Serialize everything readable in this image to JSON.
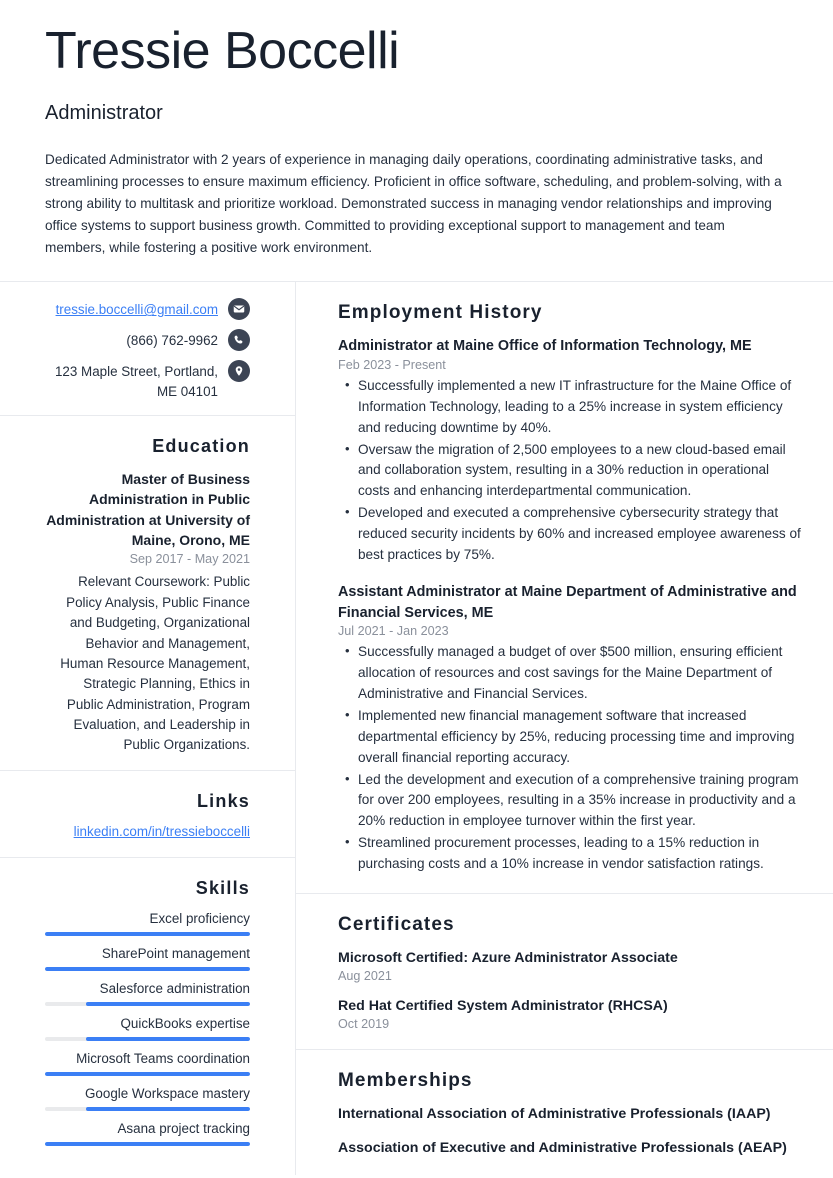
{
  "header": {
    "name": "Tressie Boccelli",
    "job_title": "Administrator",
    "summary": "Dedicated Administrator with 2 years of experience in managing daily operations, coordinating administrative tasks, and streamlining processes to ensure maximum efficiency. Proficient in office software, scheduling, and problem-solving, with a strong ability to multitask and prioritize workload. Demonstrated success in managing vendor relationships and improving office systems to support business growth. Committed to providing exceptional support to management and team members, while fostering a positive work environment."
  },
  "colors": {
    "accent": "#3b7ff5",
    "heading": "#19212e",
    "body_text": "#26303f",
    "muted": "#8a909b",
    "icon_circle": "#3c4454",
    "divider": "#e8eaee",
    "track": "#e9eaec"
  },
  "contact": {
    "email": "tressie.boccelli@gmail.com",
    "email_icon": "envelope-icon",
    "phone": "(866) 762-9962",
    "phone_icon": "phone-icon",
    "address": "123 Maple Street, Portland, ME 04101",
    "address_icon": "location-pin-icon"
  },
  "education": {
    "heading": "Education",
    "entries": [
      {
        "degree": "Master of Business Administration in Public Administration at University of Maine, Orono, ME",
        "date": "Sep 2017 - May 2021",
        "description": "Relevant Coursework: Public Policy Analysis, Public Finance and Budgeting, Organizational Behavior and Management, Human Resource Management, Strategic Planning, Ethics in Public Administration, Program Evaluation, and Leadership in Public Organizations."
      }
    ]
  },
  "links": {
    "heading": "Links",
    "items": [
      {
        "label": "linkedin.com/in/tressieboccelli"
      }
    ]
  },
  "skills": {
    "heading": "Skills",
    "items": [
      {
        "label": "Excel proficiency",
        "level": 100
      },
      {
        "label": "SharePoint management",
        "level": 100
      },
      {
        "label": "Salesforce administration",
        "level": 80
      },
      {
        "label": "QuickBooks expertise",
        "level": 80
      },
      {
        "label": "Microsoft Teams coordination",
        "level": 100
      },
      {
        "label": "Google Workspace mastery",
        "level": 80
      },
      {
        "label": "Asana project tracking",
        "level": 100
      }
    ]
  },
  "employment": {
    "heading": "Employment History",
    "jobs": [
      {
        "title": "Administrator at Maine Office of Information Technology, ME",
        "date": "Feb 2023 - Present",
        "bullets": [
          "Successfully implemented a new IT infrastructure for the Maine Office of Information Technology, leading to a 25% increase in system efficiency and reducing downtime by 40%.",
          "Oversaw the migration of 2,500 employees to a new cloud-based email and collaboration system, resulting in a 30% reduction in operational costs and enhancing interdepartmental communication.",
          "Developed and executed a comprehensive cybersecurity strategy that reduced security incidents by 60% and increased employee awareness of best practices by 75%."
        ]
      },
      {
        "title": "Assistant Administrator at Maine Department of Administrative and Financial Services, ME",
        "date": "Jul 2021 - Jan 2023",
        "bullets": [
          "Successfully managed a budget of over $500 million, ensuring efficient allocation of resources and cost savings for the Maine Department of Administrative and Financial Services.",
          "Implemented new financial management software that increased departmental efficiency by 25%, reducing processing time and improving overall financial reporting accuracy.",
          "Led the development and execution of a comprehensive training program for over 200 employees, resulting in a 35% increase in productivity and a 20% reduction in employee turnover within the first year.",
          "Streamlined procurement processes, leading to a 15% reduction in purchasing costs and a 10% increase in vendor satisfaction ratings."
        ]
      }
    ]
  },
  "certificates": {
    "heading": "Certificates",
    "items": [
      {
        "title": "Microsoft Certified: Azure Administrator Associate",
        "date": "Aug 2021"
      },
      {
        "title": "Red Hat Certified System Administrator (RHCSA)",
        "date": "Oct 2019"
      }
    ]
  },
  "memberships": {
    "heading": "Memberships",
    "items": [
      {
        "title": "International Association of Administrative Professionals (IAAP)"
      },
      {
        "title": "Association of Executive and Administrative Professionals (AEAP)"
      }
    ]
  }
}
